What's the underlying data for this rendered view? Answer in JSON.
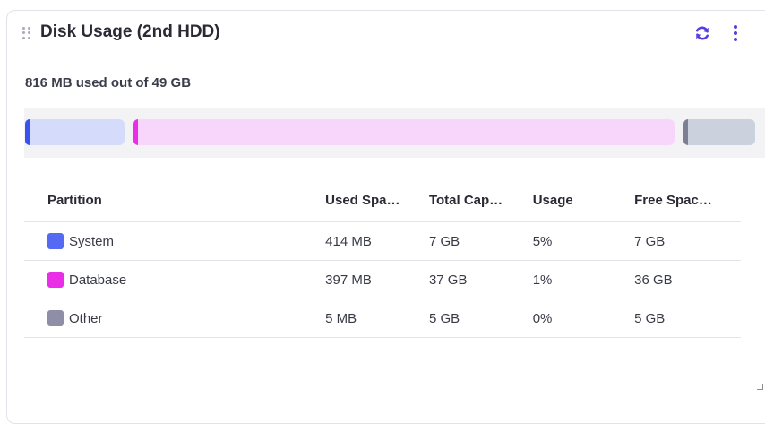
{
  "widget": {
    "title": "Disk Usage (2nd HDD)",
    "summary": "816 MB used out of 49 GB",
    "icons": {
      "drag": "drag-handle-icon",
      "refresh": "refresh-icon",
      "menu": "more-vertical-icon"
    },
    "accent": "#5b39e3"
  },
  "usage_bar": {
    "segments": [
      {
        "name": "System",
        "color": "#3a52f0",
        "fill": "#d5dcfb"
      },
      {
        "name": "Database",
        "color": "#ea2ee8",
        "fill": "#f8d6fb"
      },
      {
        "name": "Other",
        "color": "#7b8095",
        "fill": "#ccd1de"
      }
    ]
  },
  "table": {
    "headers": [
      "Partition",
      "Used Spa…",
      "Total Cap…",
      "Usage",
      "Free Spac…"
    ],
    "rows": [
      {
        "partition": "System",
        "color": "#5569f2",
        "used": "414 MB",
        "total": "7 GB",
        "usage": "5%",
        "free": "7 GB"
      },
      {
        "partition": "Database",
        "color": "#ea2ee8",
        "used": "397 MB",
        "total": "37 GB",
        "usage": "1%",
        "free": "36 GB"
      },
      {
        "partition": "Other",
        "color": "#8e8fa7",
        "used": "5 MB",
        "total": "5 GB",
        "usage": "0%",
        "free": "5 GB"
      }
    ]
  }
}
